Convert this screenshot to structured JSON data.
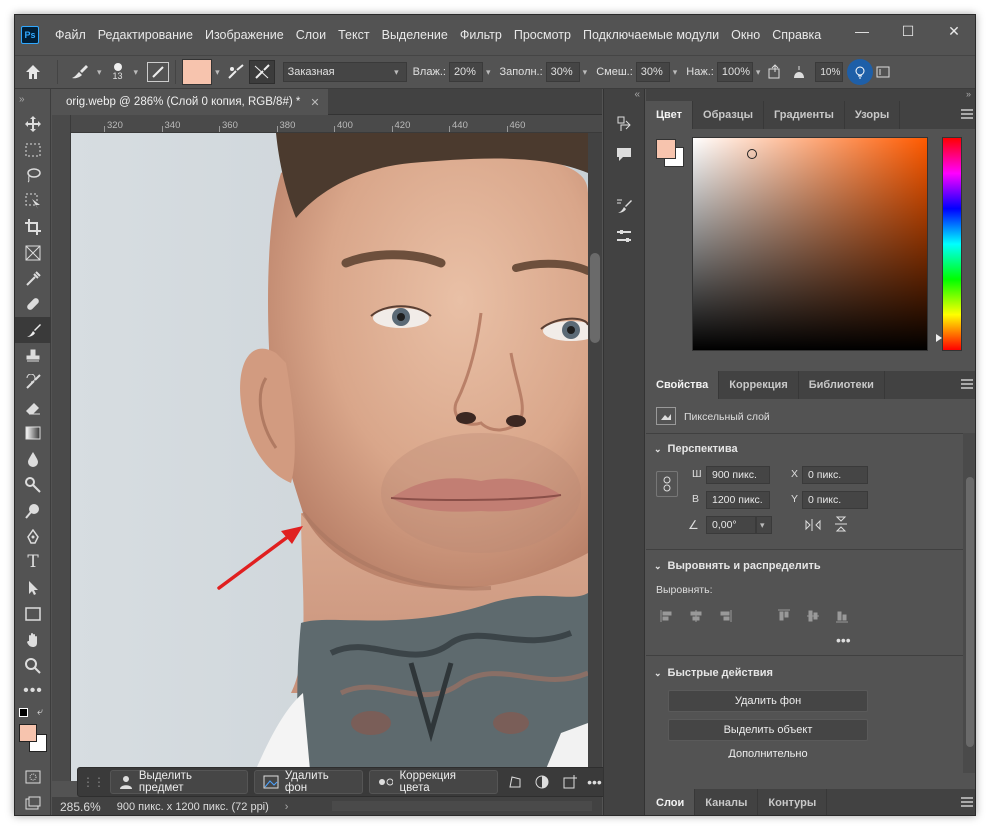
{
  "app": {
    "logo": "Ps",
    "menu": [
      "Файл",
      "Редактирование",
      "Изображение",
      "Слои",
      "Текст",
      "Выделение",
      "Фильтр",
      "Просмотр",
      "Подключаемые модули",
      "Окно",
      "Справка"
    ],
    "window_controls": [
      "minimize-icon",
      "maximize-icon",
      "close-icon"
    ]
  },
  "options": {
    "brush_size": "13",
    "foreground_color": "#f7c4ae",
    "mode": "Заказная",
    "wet_label": "Влаж.:",
    "wet_value": "20%",
    "load_label": "Заполн.:",
    "load_value": "30%",
    "mix_label": "Смеш.:",
    "mix_value": "30%",
    "flow_label": "Наж.:",
    "flow_value": "100%",
    "angle_value": "10%"
  },
  "document": {
    "tab_title": "orig.webp @ 286% (Слой 0 копия, RGB/8#) *",
    "ruler_marks": [
      "320",
      "340",
      "360",
      "380",
      "400",
      "420",
      "440",
      "460"
    ],
    "zoom": "285.6%",
    "info": "900 пикс. x 1200 пикс. (72 ppi)"
  },
  "context_bar": {
    "select_subject": "Выделить предмет",
    "remove_bg": "Удалить фон",
    "color_correction": "Коррекция цвета"
  },
  "color_panel": {
    "tabs": [
      "Цвет",
      "Образцы",
      "Градиенты",
      "Узоры"
    ],
    "foreground": "#f7c4ae",
    "background": "#ffffff",
    "hue_color": "#ff5a00"
  },
  "properties_panel": {
    "tabs": [
      "Свойства",
      "Коррекция",
      "Библиотеки"
    ],
    "layer_type": "Пиксельный слой",
    "transform_title": "Перспектива",
    "w_label": "Ш",
    "w_value": "900 пикс.",
    "h_label": "В",
    "h_value": "1200 пикс.",
    "x_label": "X",
    "x_value": "0 пикс.",
    "y_label": "Y",
    "y_value": "0 пикс.",
    "angle": "0,00°",
    "align_title": "Выровнять и распределить",
    "align_label": "Выровнять:",
    "quick_title": "Быстрые действия",
    "quick_remove_bg": "Удалить фон",
    "quick_select_object": "Выделить объект",
    "quick_more": "Дополнительно"
  },
  "layers_panel": {
    "tabs": [
      "Слои",
      "Каналы",
      "Контуры"
    ]
  }
}
